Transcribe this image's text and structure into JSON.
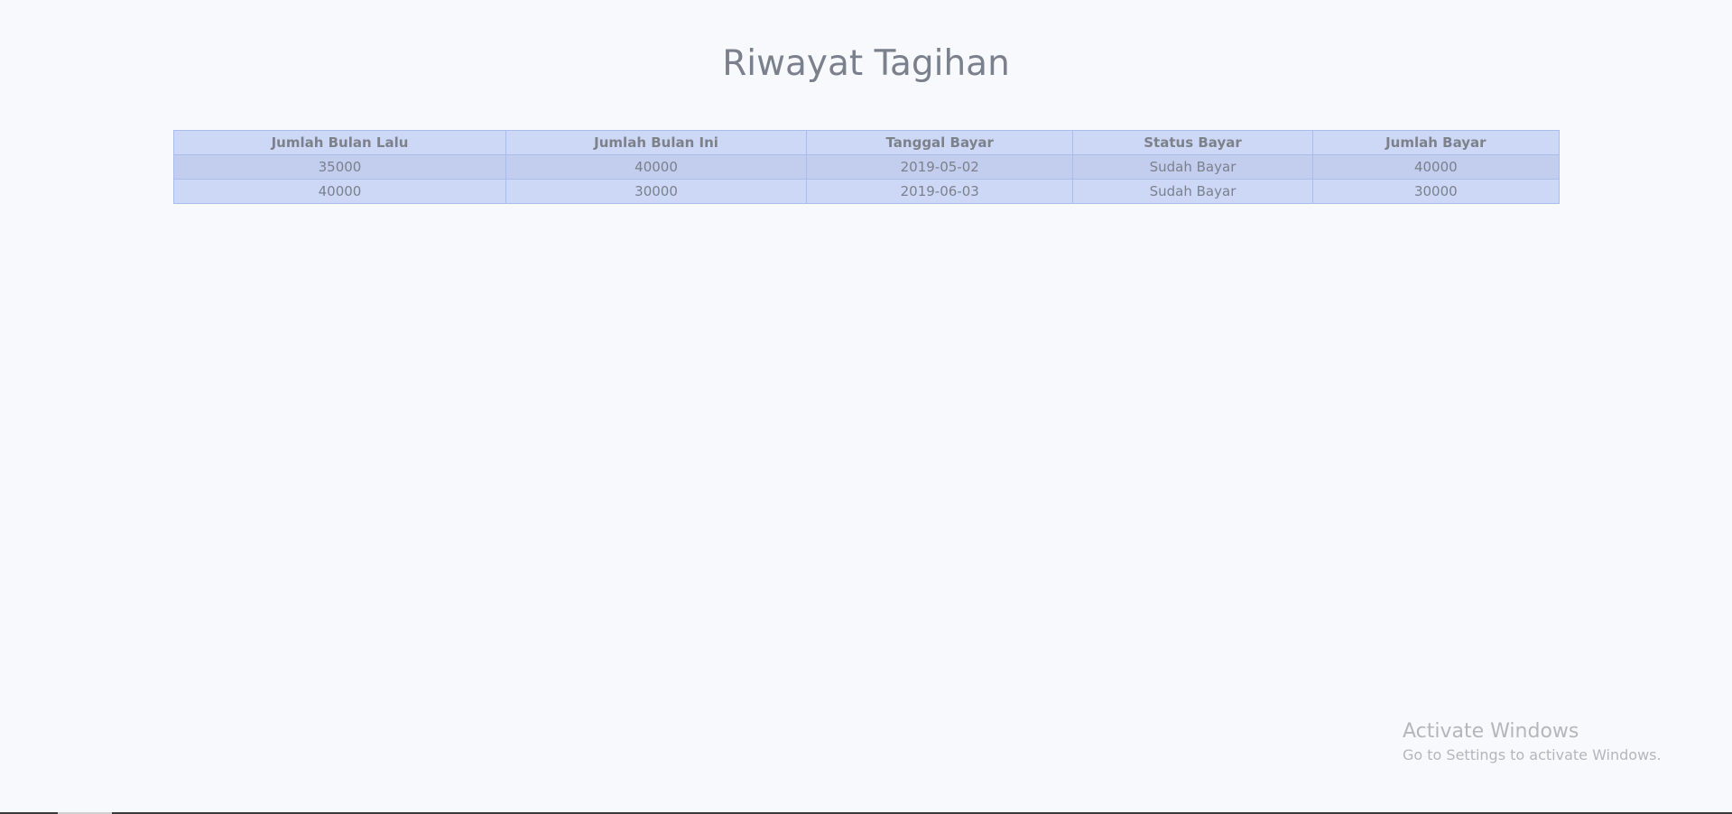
{
  "page": {
    "title": "Riwayat Tagihan"
  },
  "table": {
    "headers": [
      "Jumlah Bulan Lalu",
      "Jumlah Bulan Ini",
      "Tanggal Bayar",
      "Status Bayar",
      "Jumlah Bayar"
    ],
    "rows": [
      [
        "35000",
        "40000",
        "2019-05-02",
        "Sudah Bayar",
        "40000"
      ],
      [
        "40000",
        "30000",
        "2019-06-03",
        "Sudah Bayar",
        "30000"
      ]
    ]
  },
  "watermark": {
    "title": "Activate Windows",
    "subtitle": "Go to Settings to activate Windows."
  },
  "colors": {
    "background": "#f7f9fc",
    "table_bg": "#cdd8f6",
    "row_alt": "#c3cdee",
    "border": "#9db2ea",
    "text": "#7b818c"
  }
}
